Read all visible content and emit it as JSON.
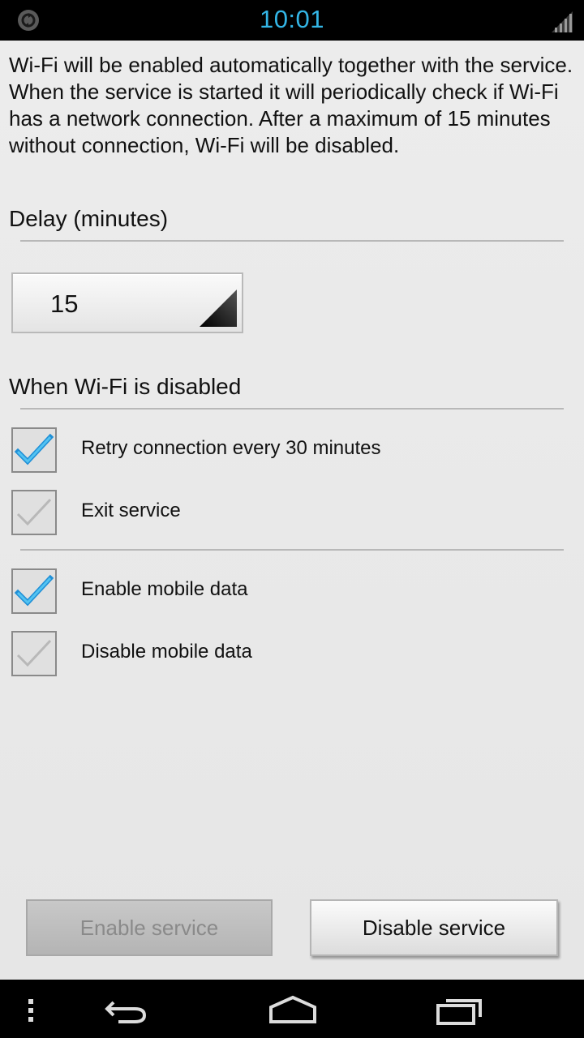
{
  "status_bar": {
    "time": "10:01",
    "accent_color": "#33b5e5",
    "icons": [
      "sync-icon",
      "signal-icon"
    ]
  },
  "info": {
    "line1": "Wi-Fi will be enabled automatically together with the service.",
    "line2": "When the service is started it will periodically check if Wi-Fi has a network connection. After a maximum of 15 minutes without connection, Wi-Fi will be disabled."
  },
  "delay": {
    "title": "Delay (minutes)",
    "selected_value": "15"
  },
  "when_disabled": {
    "title": "When Wi-Fi is disabled",
    "options": [
      {
        "label": "Retry connection every 30 minutes",
        "checked": true
      },
      {
        "label": "Exit service",
        "checked": false
      }
    ]
  },
  "mobile_data": {
    "options": [
      {
        "label": "Enable mobile data",
        "checked": true
      },
      {
        "label": "Disable mobile data",
        "checked": false
      }
    ]
  },
  "buttons": {
    "enable_label": "Enable service",
    "enable_state": "disabled",
    "disable_label": "Disable service"
  },
  "nav_bar": {
    "icons": [
      "menu-icon",
      "back-icon",
      "home-icon",
      "recent-apps-icon"
    ]
  }
}
